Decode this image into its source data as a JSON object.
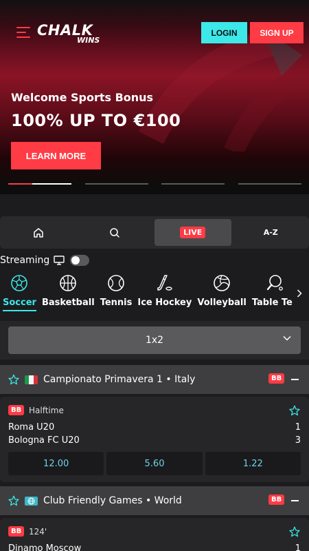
{
  "header": {
    "brand_main": "CHALK",
    "brand_sub": "WINS",
    "login_label": "LOGIN",
    "signup_label": "SIGN UP"
  },
  "promo": {
    "title": "Welcome Sports Bonus",
    "headline": "100% UP TO €100",
    "cta_label": "LEARN MORE",
    "slides": 4,
    "active_slide": 1
  },
  "nav": {
    "live_label": "LIVE",
    "az_label": "A-Z"
  },
  "streaming": {
    "label": "Streaming",
    "enabled": false
  },
  "sports": [
    {
      "label": "Soccer",
      "icon": "soccer-ball-icon",
      "active": true
    },
    {
      "label": "Basketball",
      "icon": "basketball-icon",
      "active": false
    },
    {
      "label": "Tennis",
      "icon": "tennis-ball-icon",
      "active": false
    },
    {
      "label": "Ice Hockey",
      "icon": "hockey-stick-icon",
      "active": false
    },
    {
      "label": "Volleyball",
      "icon": "volleyball-icon",
      "active": false
    },
    {
      "label": "Table Ter",
      "icon": "table-tennis-icon",
      "active": false
    }
  ],
  "market": {
    "selected": "1x2"
  },
  "leagues": [
    {
      "name": "Campionato Primavera 1 • Italy",
      "badge": "BB",
      "match": {
        "badge": "BB",
        "status": "Halftime",
        "home": "Roma U20",
        "away": "Bologna FC U20",
        "home_score": "1",
        "away_score": "3",
        "odds": [
          "12.00",
          "5.60",
          "1.22"
        ]
      }
    },
    {
      "name": "Club Friendly Games • World",
      "badge": "BB",
      "match": {
        "badge": "BB",
        "status": "124'",
        "home": "Dinamo Moscow",
        "home_score": "1"
      }
    }
  ],
  "colors": {
    "accent_red": "#ff3b45",
    "accent_cyan": "#3de8e8",
    "odds_text": "#6fd3e8"
  }
}
